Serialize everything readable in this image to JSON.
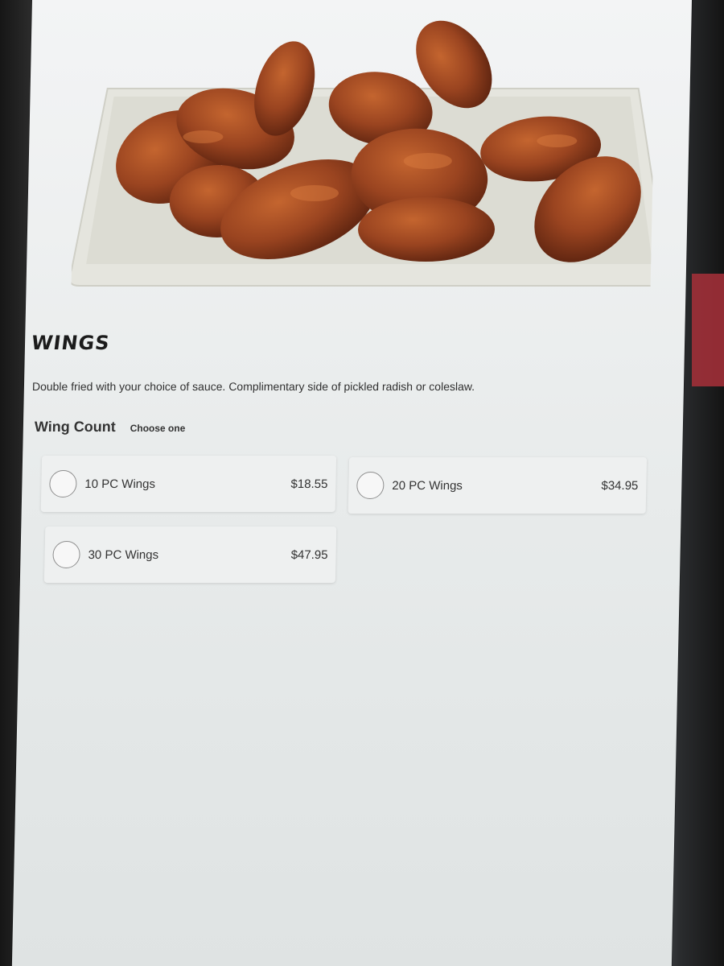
{
  "item": {
    "title": "WINGS",
    "description": "Double fried with your choice of sauce. Complimentary side of pickled radish or coleslaw."
  },
  "modifier_group": {
    "label": "Wing Count",
    "hint": "Choose one",
    "options": [
      {
        "name": "10 PC Wings",
        "price": "$18.55"
      },
      {
        "name": "20 PC Wings",
        "price": "$34.95"
      },
      {
        "name": "30 PC Wings",
        "price": "$47.95"
      }
    ]
  },
  "colors": {
    "screen_bg": "#eceeee",
    "card_bg": "#eef0f0",
    "text": "#333333",
    "wing_brown": "#8a3a1c"
  }
}
